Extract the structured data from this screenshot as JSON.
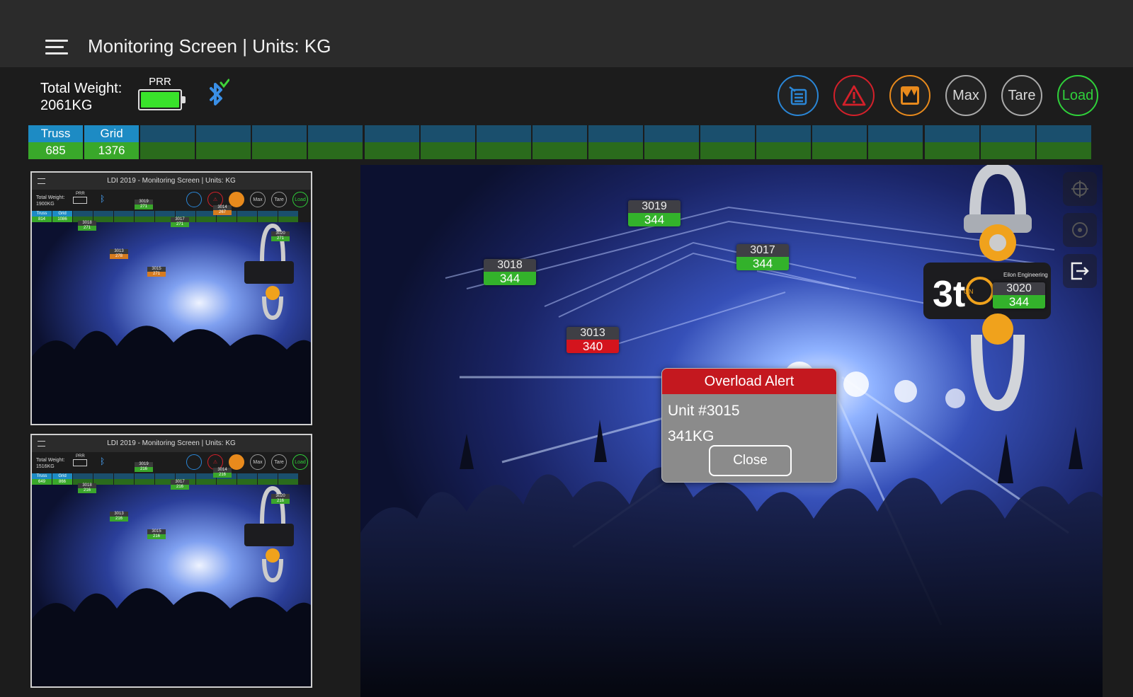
{
  "header": {
    "title": "Monitoring Screen | Units: KG",
    "menu_icon": "hamburger-menu-icon"
  },
  "status": {
    "total_weight_label": "Total Weight:",
    "total_weight_value": "2061KG",
    "battery_label": "PRR",
    "battery_level": 1.0,
    "bluetooth_icon": "bluetooth-connected-icon"
  },
  "toolbar": {
    "report_icon": "report-list-icon",
    "alert_icon": "warning-triangle-icon",
    "chart_icon": "chart-icon",
    "max_label": "Max",
    "tare_label": "Tare",
    "load_label": "Load"
  },
  "groups": [
    {
      "name": "Truss",
      "value": "685",
      "active": true
    },
    {
      "name": "Grid",
      "value": "1376",
      "active": true
    }
  ],
  "empty_group_slots": 17,
  "thumbnails": [
    {
      "title": "LDI 2019 - Monitoring Screen | Units: KG",
      "total_weight_label": "Total Weight:",
      "total_weight_value": "1900KG",
      "battery_label": "PRR",
      "groups": [
        {
          "name": "Truss",
          "value": "814"
        },
        {
          "name": "Grid",
          "value": "1086"
        }
      ],
      "tags": [
        {
          "id": "3019",
          "value": "271",
          "status": "ok"
        },
        {
          "id": "3014",
          "value": "267",
          "status": "warn"
        },
        {
          "id": "3018",
          "value": "271",
          "status": "ok"
        },
        {
          "id": "3017",
          "value": "271",
          "status": "ok"
        },
        {
          "id": "3013",
          "value": "278",
          "status": "warn"
        },
        {
          "id": "3015",
          "value": "271",
          "status": "warn"
        },
        {
          "id": "3020",
          "value": "271",
          "status": "ok"
        }
      ]
    },
    {
      "title": "LDI 2019 - Monitoring Screen | Units: KG",
      "total_weight_label": "Total Weight:",
      "total_weight_value": "1516KG",
      "battery_label": "PRR",
      "groups": [
        {
          "name": "Truss",
          "value": "649"
        },
        {
          "name": "Grid",
          "value": "866"
        }
      ],
      "tags": [
        {
          "id": "3019",
          "value": "216",
          "status": "ok"
        },
        {
          "id": "3014",
          "value": "216",
          "status": "ok"
        },
        {
          "id": "3018",
          "value": "216",
          "status": "ok"
        },
        {
          "id": "3017",
          "value": "216",
          "status": "ok"
        },
        {
          "id": "3013",
          "value": "216",
          "status": "ok"
        },
        {
          "id": "3015",
          "value": "216",
          "status": "ok"
        },
        {
          "id": "3020",
          "value": "216",
          "status": "ok"
        }
      ]
    }
  ],
  "units": [
    {
      "id": "3019",
      "value": "344",
      "status": "ok"
    },
    {
      "id": "3018",
      "value": "344",
      "status": "ok"
    },
    {
      "id": "3017",
      "value": "344",
      "status": "ok"
    },
    {
      "id": "3013",
      "value": "340",
      "status": "alert"
    },
    {
      "id": "3020",
      "value": "344",
      "status": "ok"
    }
  ],
  "device": {
    "capacity_label": "3t",
    "brand_text": "Eilon Engineering",
    "on_label": "ON"
  },
  "side_tools": [
    "crosshair-icon",
    "target-icon",
    "exit-icon"
  ],
  "alert": {
    "title": "Overload Alert",
    "unit_line": "Unit #3015",
    "weight_line": "341KG",
    "close_label": "Close"
  },
  "colors": {
    "ok": "#33b22b",
    "alert": "#d4141d",
    "warn": "#d67b1f",
    "active_group": "#1d8bc4"
  }
}
